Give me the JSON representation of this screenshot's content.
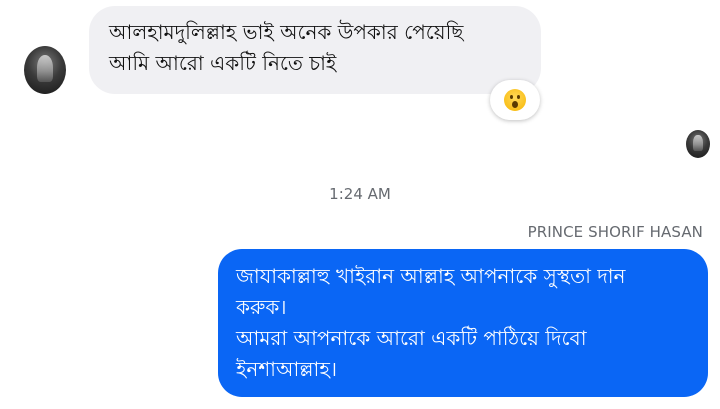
{
  "incoming_message": {
    "lines": [
      "আলহামদুলিল্লাহ ভাই অনেক উপকার পেয়েছি",
      "আমি আরো একটি নিতে চাই"
    ],
    "reaction": "astonished-face-emoji"
  },
  "timestamp": "1:24 AM",
  "outgoing_message": {
    "sender_name": "PRINCE SHORIF HASAN",
    "lines": [
      "জাযাকাল্লাহু খাইরান আল্লাহ আপনাকে সুস্থতা দান",
      "করুক।",
      "আমরা আপনাকে আরো একটি পাঠিয়ে দিবো",
      "ইনশাআল্লাহ।"
    ]
  },
  "colors": {
    "incoming_bubble": "#f0f0f3",
    "outgoing_bubble": "#0a66f5",
    "meta_text": "#666a70"
  }
}
